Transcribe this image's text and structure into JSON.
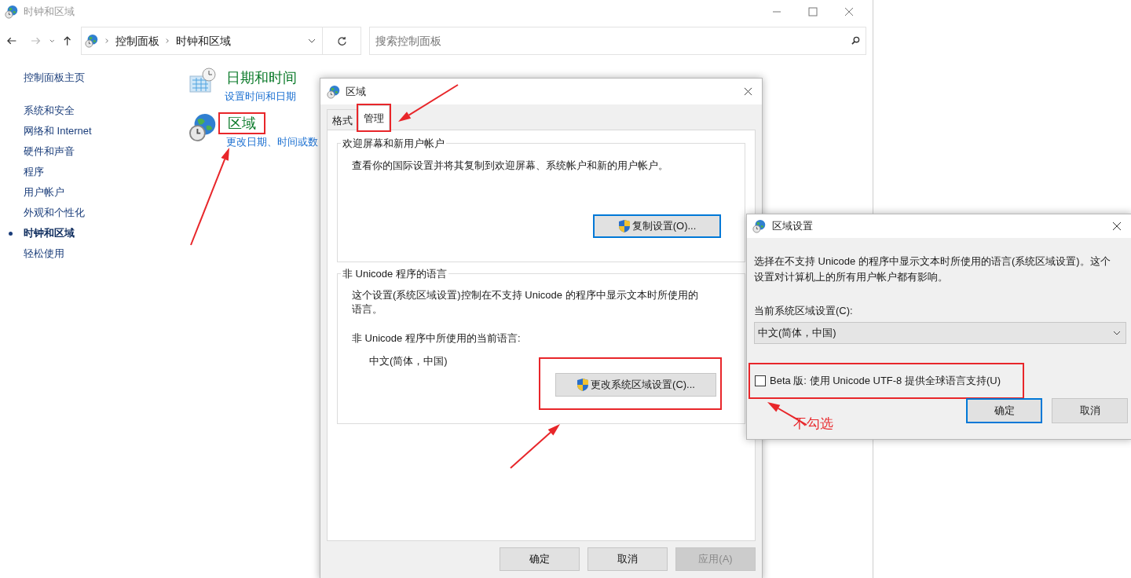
{
  "window": {
    "title": "时钟和区域"
  },
  "address_bar": {
    "breadcrumb": [
      "控制面板",
      "时钟和区域"
    ]
  },
  "search": {
    "placeholder": "搜索控制面板"
  },
  "sidebar": {
    "home": "控制面板主页",
    "items": [
      {
        "label": "系统和安全",
        "selected": false
      },
      {
        "label": "网络和 Internet",
        "selected": false
      },
      {
        "label": "硬件和声音",
        "selected": false
      },
      {
        "label": "程序",
        "selected": false
      },
      {
        "label": "用户帐户",
        "selected": false
      },
      {
        "label": "外观和个性化",
        "selected": false
      },
      {
        "label": "时钟和区域",
        "selected": true
      },
      {
        "label": "轻松使用",
        "selected": false
      }
    ]
  },
  "categories": [
    {
      "kind": "calendar",
      "title": "日期和时间",
      "link": "设置时间和日期",
      "highlighted": false
    },
    {
      "kind": "globe",
      "title": "区域",
      "link": "更改日期、时间或数",
      "highlighted": true
    }
  ],
  "region_dialog": {
    "title": "区域",
    "tabs": [
      {
        "label": "格式",
        "selected": false,
        "highlighted": false
      },
      {
        "label": "管理",
        "selected": true,
        "highlighted": true
      }
    ],
    "welcome_group": {
      "title": "欢迎屏幕和新用户帐户",
      "description": "查看你的国际设置并将其复制到欢迎屏幕、系统帐户和新的用户帐户。",
      "button": "复制设置(O)...",
      "focused": true
    },
    "unicode_group": {
      "title": "非 Unicode 程序的语言",
      "description": "这个设置(系统区域设置)控制在不支持 Unicode 的程序中显示文本时所使用的语言。",
      "current_label": "非 Unicode 程序中所使用的当前语言:",
      "current_value": "中文(简体，中国)",
      "button": "更改系统区域设置(C)...",
      "highlighted": true
    },
    "buttons": [
      {
        "label": "确定",
        "disabled": false
      },
      {
        "label": "取消",
        "disabled": false
      },
      {
        "label": "应用(A)",
        "disabled": true
      }
    ]
  },
  "locale_dialog": {
    "title": "区域设置",
    "description": "选择在不支持 Unicode 的程序中显示文本时所使用的语言(系统区域设置)。这个设置对计算机上的所有用户帐户都有影响。",
    "field_label": "当前系统区域设置(C):",
    "value": "中文(简体，中国)",
    "beta": {
      "label": "Beta 版: 使用 Unicode UTF-8 提供全球语言支持(U)",
      "checked": false,
      "highlighted": true
    },
    "buttons": [
      {
        "label": "确定",
        "default": true
      },
      {
        "label": "取消",
        "default": false
      }
    ]
  },
  "annotation": {
    "note": "不勾选"
  }
}
